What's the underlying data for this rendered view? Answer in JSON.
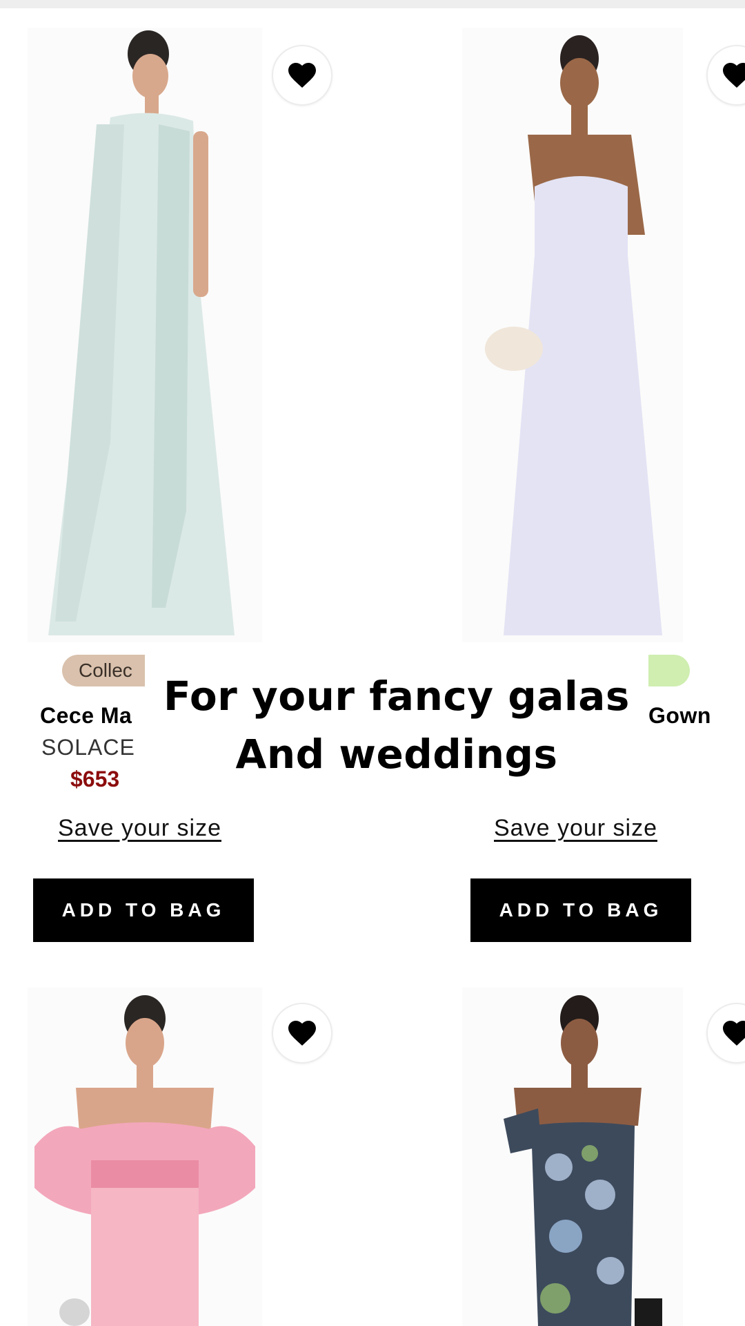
{
  "overlay": {
    "line1": "For your fancy galas",
    "line2": "And weddings"
  },
  "products": [
    {
      "badge": "Collec",
      "badge_color": "#d9c1ad",
      "name": "Cece Ma",
      "brand": "SOLACE",
      "price": "$653",
      "save_label": "Save your size",
      "add_label": "ADD TO BAG",
      "dress_color": "#dbe9e6"
    },
    {
      "badge_color": "#cfeeb0",
      "name": "Gown",
      "save_label": "Save your size",
      "add_label": "ADD TO BAG",
      "dress_color": "#e3e3f4"
    },
    {
      "dress_color": "#f6b6c4",
      "sleeve_color": "#f3a7bb"
    },
    {
      "dress_color": "#3d4a5c",
      "pattern_color": "#9fb0c9"
    }
  ],
  "colors": {
    "price": "#8c0d0d",
    "button_bg": "#000000",
    "button_text": "#ffffff"
  },
  "icons": {
    "favorite": "heart-icon"
  }
}
